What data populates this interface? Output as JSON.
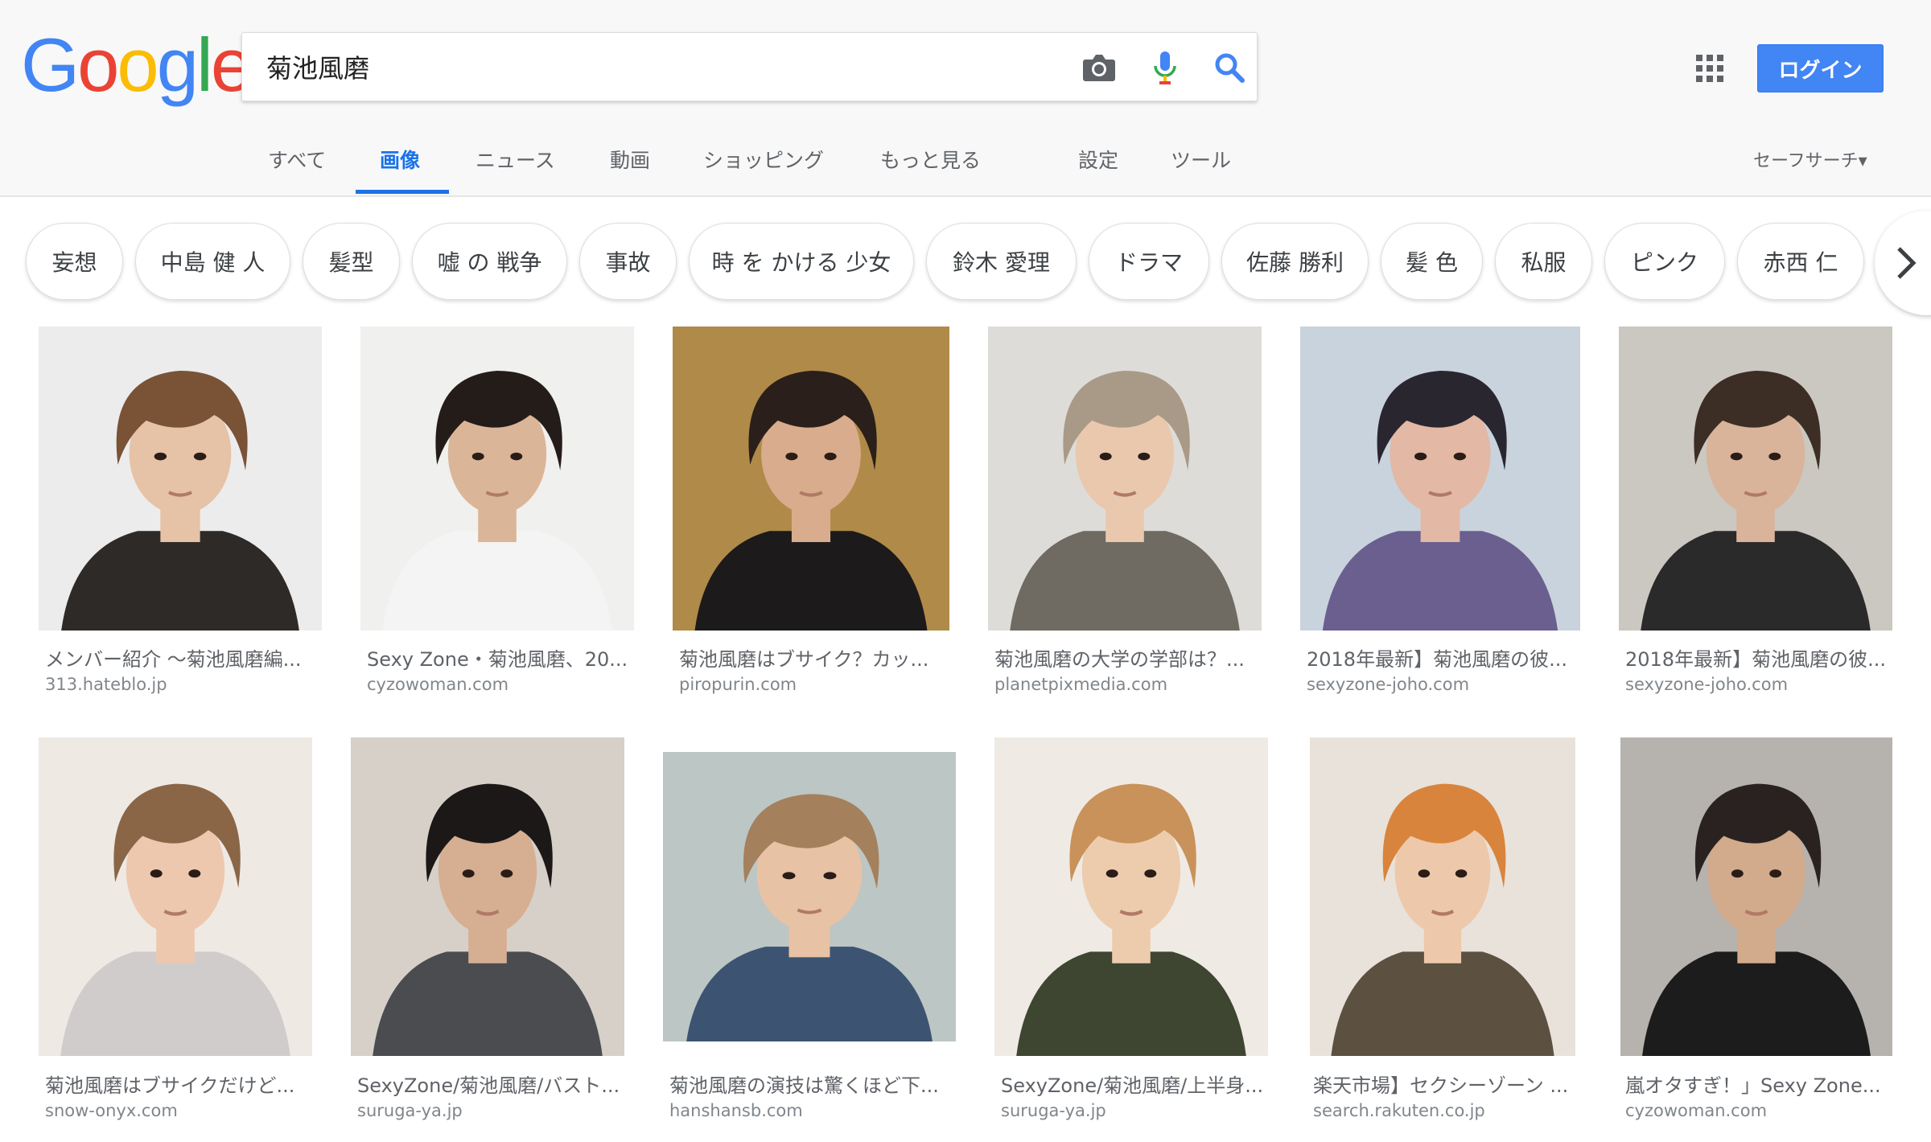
{
  "logo": {
    "letters": [
      "G",
      "o",
      "o",
      "g",
      "l",
      "e"
    ],
    "colors": [
      "#4285f4",
      "#ea4335",
      "#fbbc05",
      "#4285f4",
      "#34a853",
      "#ea4335"
    ]
  },
  "search": {
    "query": "菊池風磨"
  },
  "icons": {
    "camera": "camera-icon",
    "mic": "microphone-icon",
    "search": "search-icon",
    "apps": "apps-grid-icon"
  },
  "login_label": "ログイン",
  "nav": {
    "tabs": [
      "すべて",
      "画像",
      "ニュース",
      "動画",
      "ショッピング",
      "もっと見る",
      "設定",
      "ツール"
    ],
    "active": "画像",
    "safesearch": "セーフサーチ▾"
  },
  "chips": [
    "妄想",
    "中島 健 人",
    "髪型",
    "嘘 の 戦争",
    "事故",
    "時 を かける 少女",
    "鈴木 愛理",
    "ドラマ",
    "佐藤 勝利",
    "髪 色",
    "私服",
    "ピンク",
    "赤西 仁"
  ],
  "results": [
    {
      "title": "メンバー紹介 〜菊池風磨編...",
      "site": "313.hateblo.jp"
    },
    {
      "title": "Sexy Zone・菊池風磨、20...",
      "site": "cyzowoman.com"
    },
    {
      "title": "菊池風磨はブサイク？カッ...",
      "site": "piropurin.com"
    },
    {
      "title": "菊池風磨の大学の学部は？...",
      "site": "planetpixmedia.com"
    },
    {
      "title": "2018年最新】菊池風磨の彼...",
      "site": "sexyzone-joho.com"
    },
    {
      "title": "2018年最新】菊池風磨の彼...",
      "site": "sexyzone-joho.com"
    },
    {
      "title": "菊池風磨はブサイクだけど...",
      "site": "snow-onyx.com"
    },
    {
      "title": "SexyZone/菊池風磨/バスト...",
      "site": "suruga-ya.jp"
    },
    {
      "title": "菊池風磨の演技は驚くほど下...",
      "site": "hanshansb.com"
    },
    {
      "title": "SexyZone/菊池風磨/上半身...",
      "site": "suruga-ya.jp"
    },
    {
      "title": "楽天市場】セクシーゾーン ...",
      "site": "search.rakuten.co.jp"
    },
    {
      "title": "嵐オタすぎ！」Sexy Zone...",
      "site": "cyzowoman.com"
    }
  ],
  "thumb_palettes": [
    {
      "bg": "#ececec",
      "hair": "#7a5236",
      "skin": "#e6c2a6",
      "cloth": "#2e2a28"
    },
    {
      "bg": "#f0f0ee",
      "hair": "#241c18",
      "skin": "#dbb598",
      "cloth": "#f4f4f4"
    },
    {
      "bg": "#b08a48",
      "hair": "#2a1f1a",
      "skin": "#d8ac8c",
      "cloth": "#1c1a1a"
    },
    {
      "bg": "#dedcd8",
      "hair": "#a89a86",
      "skin": "#e9c8ae",
      "cloth": "#6f6a62"
    },
    {
      "bg": "#c9d3dd",
      "hair": "#2a2630",
      "skin": "#e3b8a4",
      "cloth": "#6a5f8e"
    },
    {
      "bg": "#cbc7c1",
      "hair": "#3c2e24",
      "skin": "#d9b49a",
      "cloth": "#2a2a2a"
    },
    {
      "bg": "#efe9e4",
      "hair": "#8a6646",
      "skin": "#edc8ae",
      "cloth": "#d0cccc"
    },
    {
      "bg": "#d6d0c8",
      "hair": "#1c1818",
      "skin": "#d6ae92",
      "cloth": "#4a4c50"
    },
    {
      "bg": "#bcc6c4",
      "hair": "#a4805c",
      "skin": "#e8c2a4",
      "cloth": "#3c5472"
    },
    {
      "bg": "#efebe4",
      "hair": "#c9925a",
      "skin": "#edccae",
      "cloth": "#3e4632"
    },
    {
      "bg": "#e8e2da",
      "hair": "#d9843c",
      "skin": "#edc8aa",
      "cloth": "#5c5040"
    },
    {
      "bg": "#b6b2ae",
      "hair": "#2a2220",
      "skin": "#d2aa8c",
      "cloth": "#1c1c1c"
    }
  ]
}
